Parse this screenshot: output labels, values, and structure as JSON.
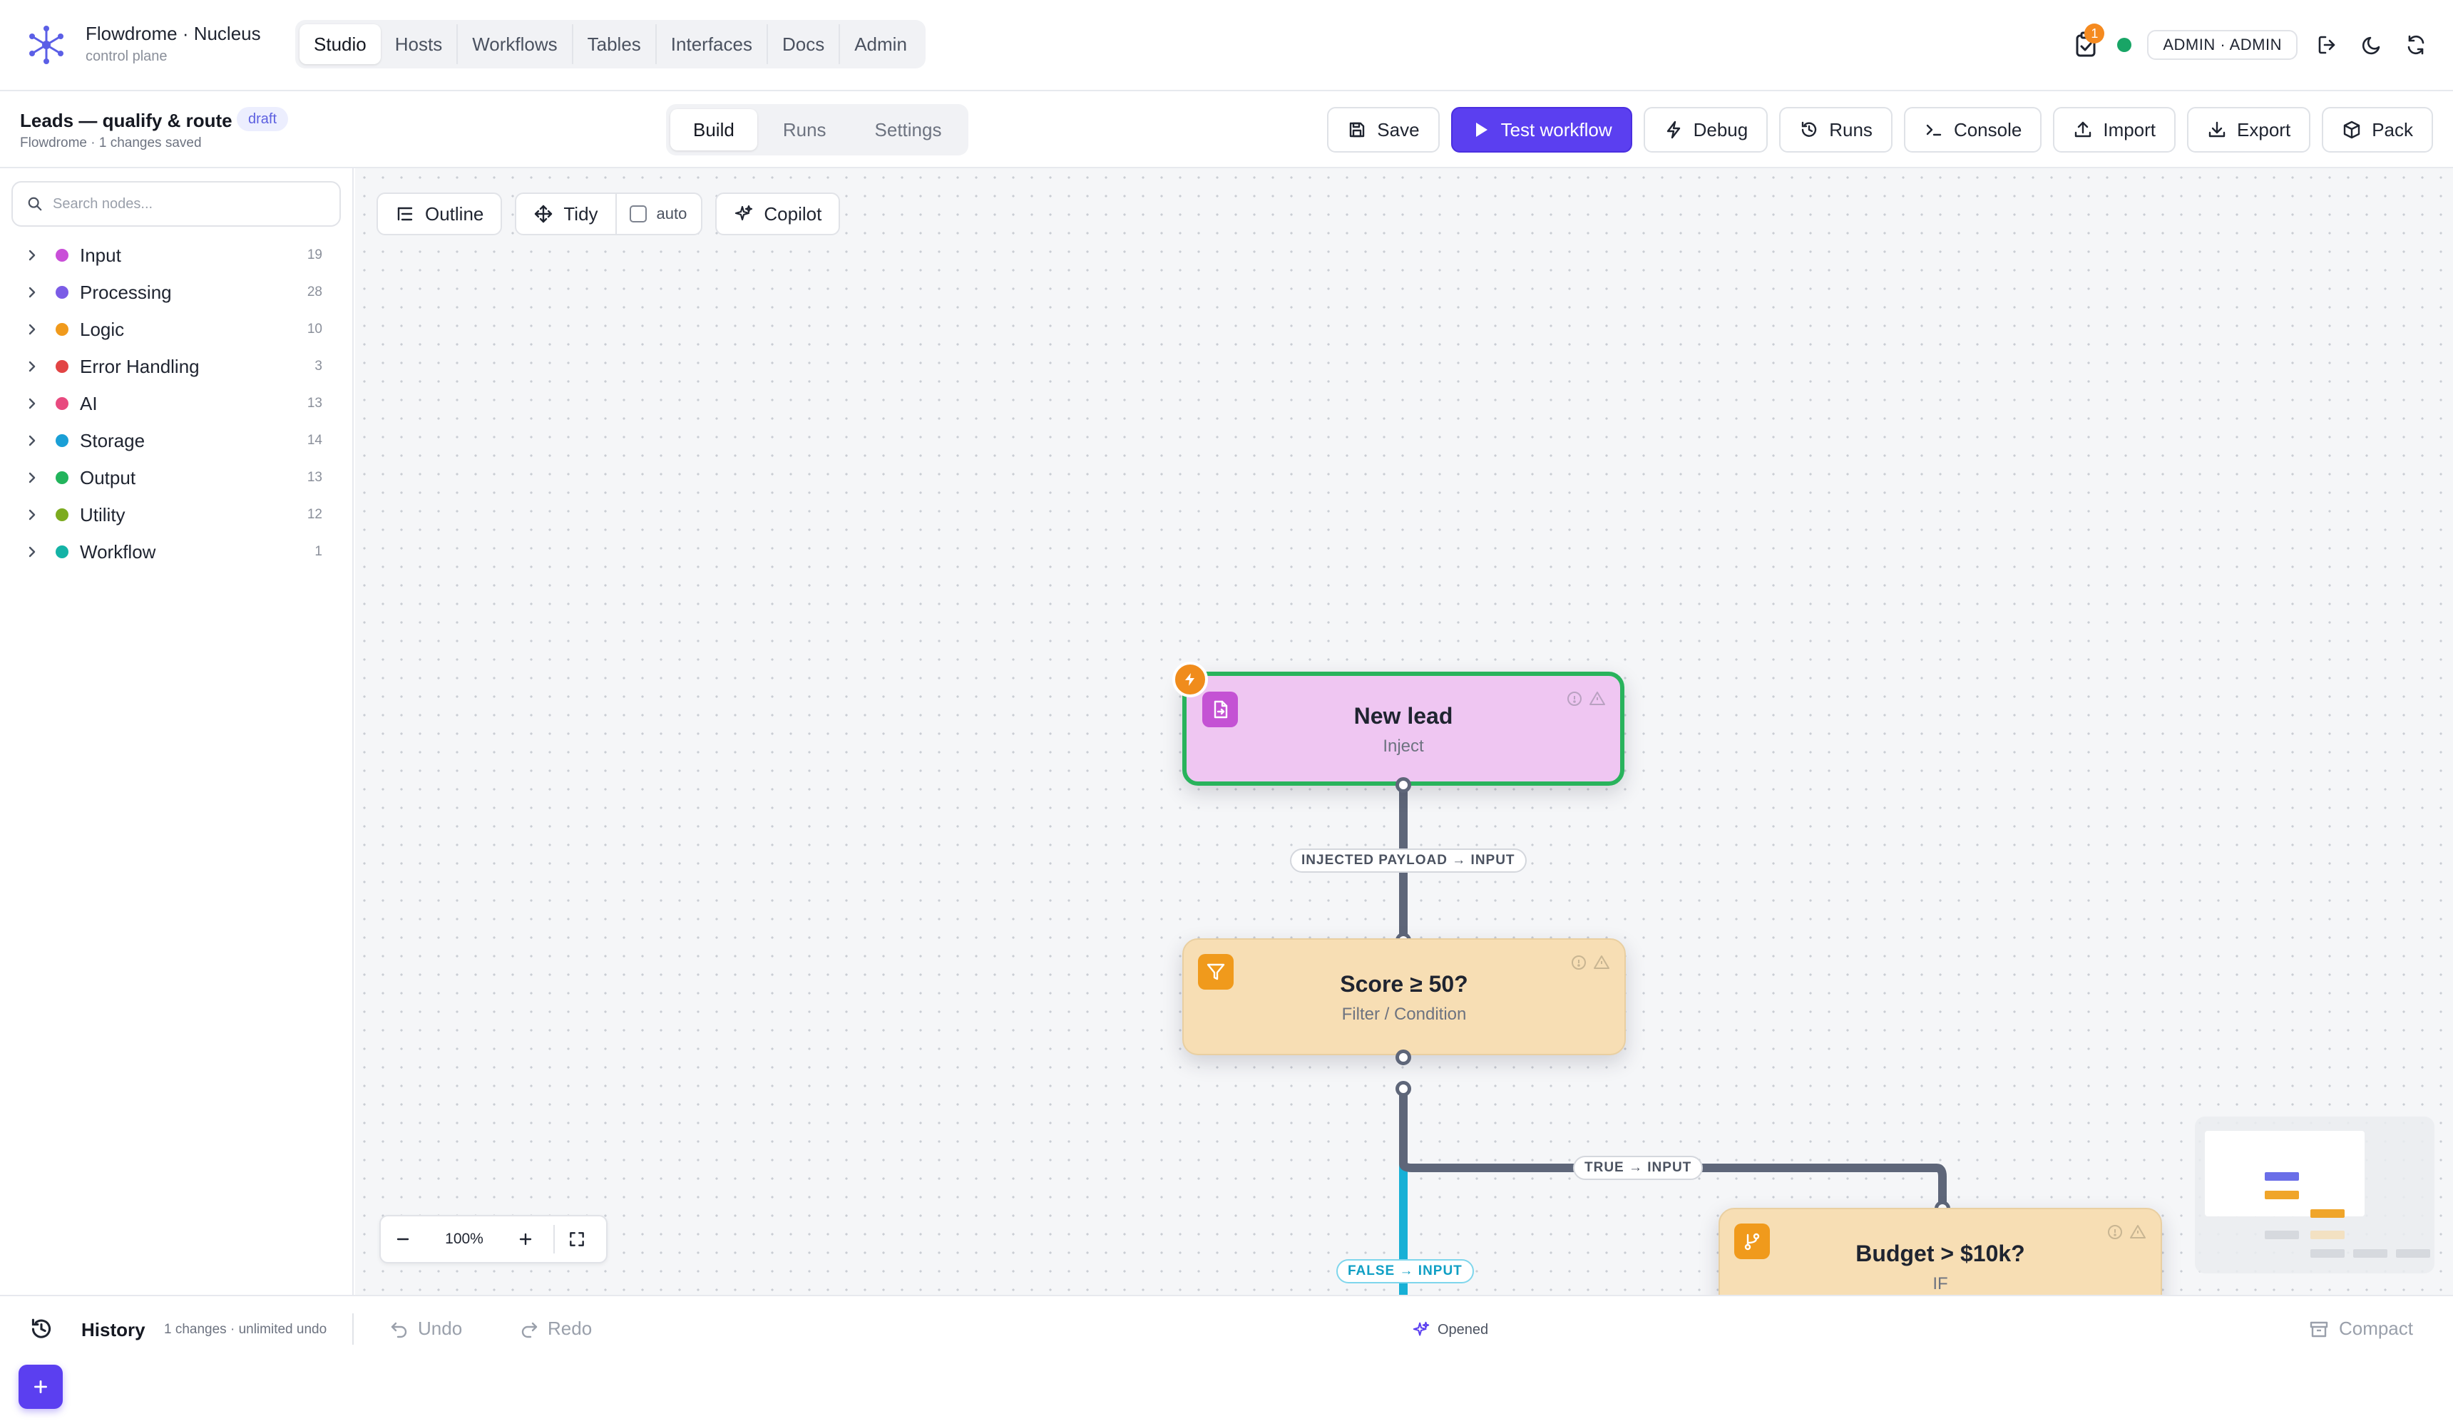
{
  "brand": {
    "title": "Flowdrome · Nucleus",
    "subtitle": "control plane"
  },
  "nav": {
    "tabs": [
      {
        "label": "Studio",
        "active": true
      },
      {
        "label": "Hosts"
      },
      {
        "label": "Workflows"
      },
      {
        "label": "Tables"
      },
      {
        "label": "Interfaces"
      },
      {
        "label": "Docs"
      },
      {
        "label": "Admin"
      }
    ]
  },
  "topbar": {
    "notification_count": "1",
    "user": "ADMIN · ADMIN",
    "status_color": "#18a566"
  },
  "workflow": {
    "title": "Leads — qualify & route",
    "badge": "draft",
    "subtitle": "Flowdrome · 1 changes saved"
  },
  "mode_tabs": [
    {
      "label": "Build",
      "active": true
    },
    {
      "label": "Runs"
    },
    {
      "label": "Settings"
    }
  ],
  "actions": {
    "save": "Save",
    "test": "Test workflow",
    "debug": "Debug",
    "runs": "Runs",
    "console": "Console",
    "import": "Import",
    "export": "Export",
    "pack": "Pack"
  },
  "palette": {
    "search_placeholder": "Search nodes...",
    "categories": [
      {
        "label": "Input",
        "count": "19",
        "color": "#c94fd8"
      },
      {
        "label": "Processing",
        "count": "28",
        "color": "#7b5ce6"
      },
      {
        "label": "Logic",
        "count": "10",
        "color": "#f09a1c"
      },
      {
        "label": "Error Handling",
        "count": "3",
        "color": "#e24444"
      },
      {
        "label": "AI",
        "count": "13",
        "color": "#e84a7f"
      },
      {
        "label": "Storage",
        "count": "14",
        "color": "#1a9fd6"
      },
      {
        "label": "Output",
        "count": "13",
        "color": "#22b45c"
      },
      {
        "label": "Utility",
        "count": "12",
        "color": "#7cab1f"
      },
      {
        "label": "Workflow",
        "count": "1",
        "color": "#14b3a6"
      }
    ]
  },
  "canvas_toolbar": {
    "outline": "Outline",
    "tidy": "Tidy",
    "auto": "auto",
    "copilot": "Copilot"
  },
  "nodes": {
    "inject": {
      "title": "New lead",
      "type": "Inject"
    },
    "filter": {
      "title": "Score ≥ 50?",
      "type": "Filter / Condition"
    },
    "if": {
      "title": "Budget > $10k?",
      "type": "IF"
    }
  },
  "edges": {
    "inject_to_filter": "INJECTED PAYLOAD → INPUT",
    "true_branch": "TRUE → INPUT",
    "false_branch": "FALSE → INPUT"
  },
  "zoom": {
    "value": "100%"
  },
  "history": {
    "title": "History",
    "subtitle": "1 changes · unlimited undo",
    "undo": "Undo",
    "redo": "Redo",
    "copilot_status": "Opened",
    "compact": "Compact"
  },
  "colors": {
    "accent": "#5b3ff0",
    "edge": "#5e6679",
    "false_edge": "#17b0d6",
    "selected": "#29b35c"
  }
}
